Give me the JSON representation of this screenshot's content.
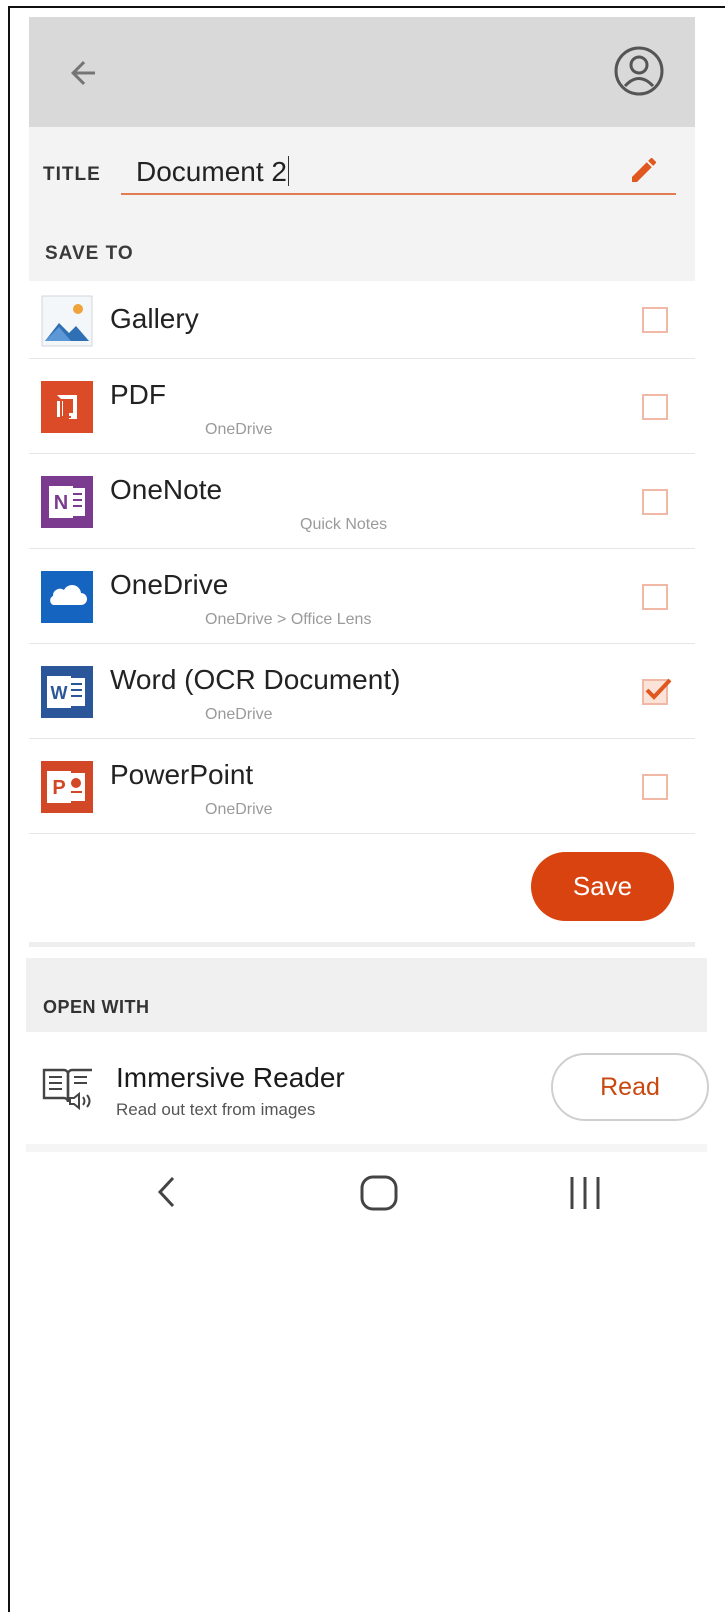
{
  "header": {
    "back_icon": "arrow-left-icon",
    "account_icon": "account-circle-icon",
    "bg_color": "#d9d9d9"
  },
  "title_field": {
    "label": "TITLE",
    "value": "Document 2",
    "edit_icon": "pencil-icon",
    "accent": "#e27b52"
  },
  "save_to": {
    "header": "SAVE TO",
    "items": [
      {
        "name": "Gallery",
        "sub": "",
        "icon": "gallery-icon",
        "checked": false
      },
      {
        "name": "PDF",
        "sub": "OneDrive",
        "icon": "pdf-icon",
        "checked": false
      },
      {
        "name": "OneNote",
        "sub": "Quick Notes",
        "icon": "onenote-icon",
        "checked": false
      },
      {
        "name": "OneDrive",
        "sub": "OneDrive > Office Lens",
        "icon": "onedrive-icon",
        "checked": false
      },
      {
        "name": "Word (OCR Document)",
        "sub": "OneDrive",
        "icon": "word-icon",
        "checked": true
      },
      {
        "name": "PowerPoint",
        "sub": "OneDrive",
        "icon": "powerpoint-icon",
        "checked": false
      }
    ]
  },
  "save_button": {
    "label": "Save",
    "color": "#d9430f"
  },
  "open_with": {
    "header": "OPEN WITH",
    "app_title": "Immersive Reader",
    "app_sub": "Read out text from images",
    "icon": "immersive-reader-icon",
    "button_label": "Read"
  },
  "nav_bar": {
    "back_icon": "nav-back-icon",
    "home_icon": "nav-home-icon",
    "recents_icon": "nav-recents-icon"
  }
}
